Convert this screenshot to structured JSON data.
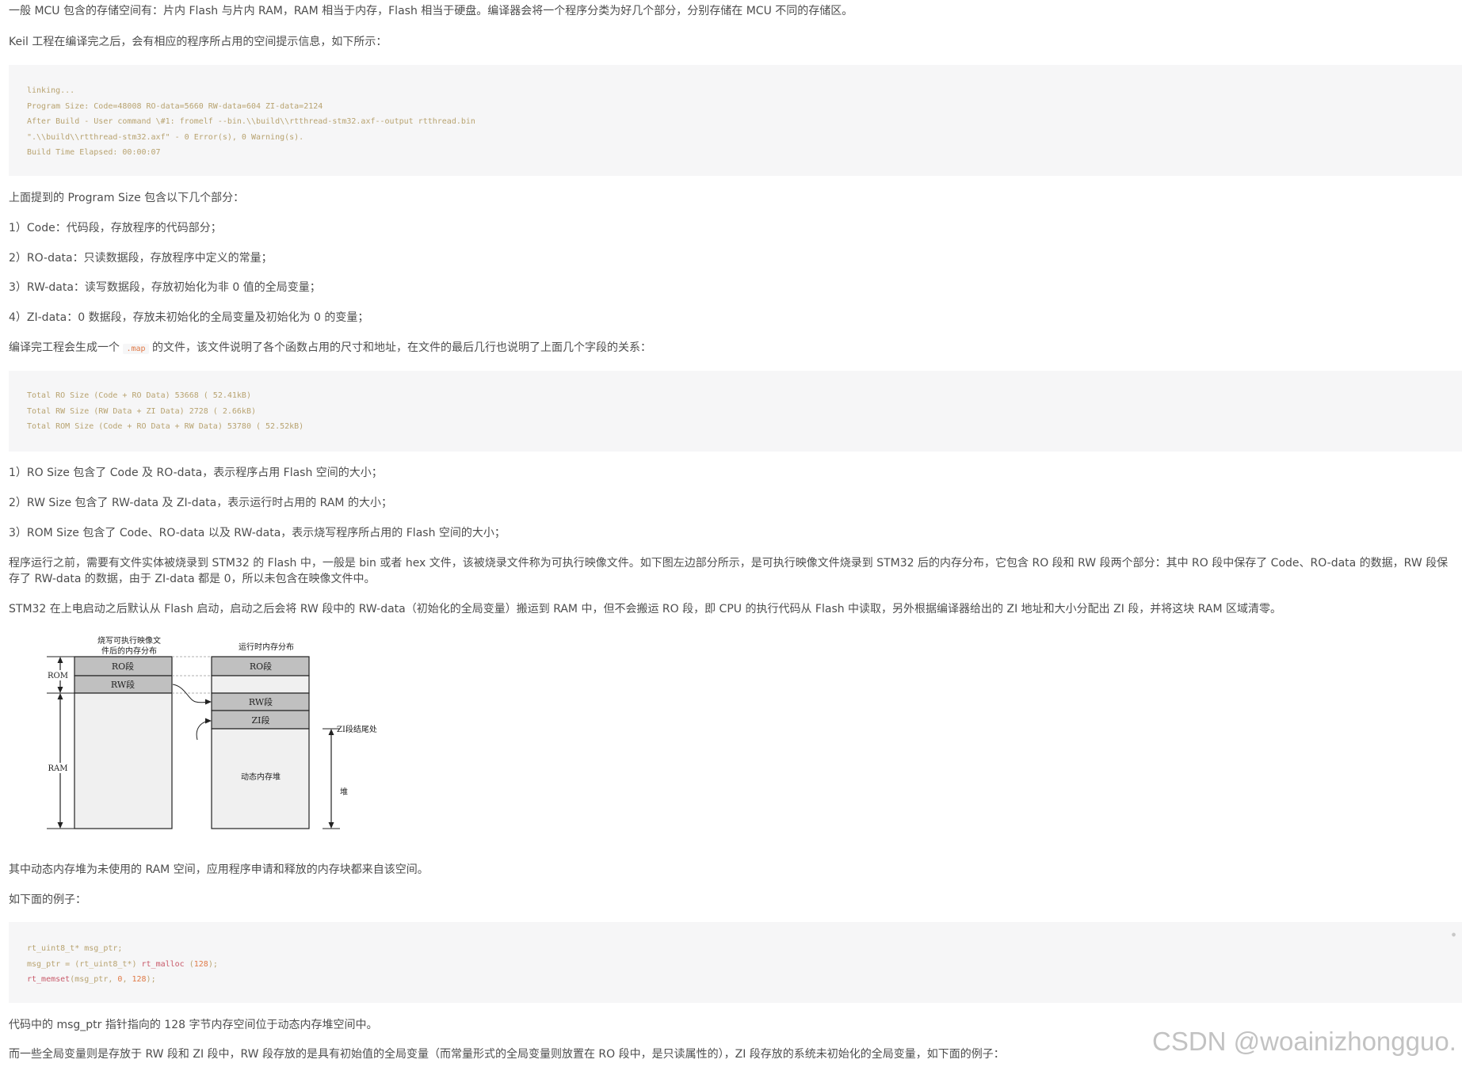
{
  "paragraphs": {
    "p1": "一般 MCU 包含的存储空间有：片内 Flash 与片内 RAM，RAM 相当于内存，Flash 相当于硬盘。编译器会将一个程序分类为好几个部分，分别存储在 MCU 不同的存储区。",
    "p2": "Keil 工程在编译完之后，会有相应的程序所占用的空间提示信息，如下所示：",
    "p3": "上面提到的 Program Size 包含以下几个部分：",
    "p4": "1）Code：代码段，存放程序的代码部分；",
    "p5": "2）RO-data：只读数据段，存放程序中定义的常量；",
    "p6": "3）RW-data：读写数据段，存放初始化为非 0 值的全局变量；",
    "p7": "4）ZI-data：0 数据段，存放未初始化的全局变量及初始化为 0 的变量；",
    "p8_before": "编译完工程会生成一个",
    "p8_code": ".map",
    "p8_after": "的文件，该文件说明了各个函数占用的尺寸和地址，在文件的最后几行也说明了上面几个字段的关系：",
    "p9": "1）RO Size 包含了 Code 及 RO-data，表示程序占用 Flash 空间的大小；",
    "p10": "2）RW Size 包含了 RW-data 及 ZI-data，表示运行时占用的 RAM 的大小；",
    "p11": "3）ROM Size 包含了 Code、RO-data 以及 RW-data，表示烧写程序所占用的 Flash 空间的大小；",
    "p12": "程序运行之前，需要有文件实体被烧录到 STM32 的 Flash 中，一般是 bin 或者 hex 文件，该被烧录文件称为可执行映像文件。如下图左边部分所示，是可执行映像文件烧录到 STM32 后的内存分布，它包含 RO 段和 RW 段两个部分：其中 RO 段中保存了 Code、RO-data 的数据，RW 段保存了 RW-data 的数据，由于 ZI-data 都是 0，所以未包含在映像文件中。",
    "p13": "STM32 在上电启动之后默认从 Flash 启动，启动之后会将 RW 段中的 RW-data（初始化的全局变量）搬运到 RAM 中，但不会搬运 RO 段，即 CPU 的执行代码从 Flash 中读取，另外根据编译器给出的 ZI 地址和大小分配出 ZI 段，并将这块 RAM 区域清零。",
    "p14": "其中动态内存堆为未使用的 RAM 空间，应用程序申请和释放的内存块都来自该空间。",
    "p15": "如下面的例子：",
    "p16": "代码中的 msg_ptr 指针指向的 128 字节内存空间位于动态内存堆空间中。",
    "p17": "而一些全局变量则是存放于 RW 段和 ZI 段中，RW 段存放的是具有初始值的全局变量（而常量形式的全局变量则放置在 RO 段中，是只读属性的），ZI 段存放的系统未初始化的全局变量，如下面的例子："
  },
  "code1": {
    "l1": "linking...",
    "l2": "Program Size: Code=48008 RO-data=5660 RW-data=604 ZI-data=2124",
    "l3": "After Build - User command \\#1: fromelf --bin.\\\\build\\\\rtthread-stm32.axf--output rtthread.bin",
    "l4": "\".\\\\build\\\\rtthread-stm32.axf\" - 0 Error(s), 0 Warning(s).",
    "l5": "Build Time Elapsed: 00:00:07"
  },
  "code2": {
    "l1": "Total RO Size (Code + RO Data) 53668 ( 52.41kB)",
    "l2": "Total RW Size (RW Data + ZI Data) 2728 ( 2.66kB)",
    "l3": "Total ROM Size (Code + RO Data + RW Data) 53780 ( 52.52kB)"
  },
  "code3": {
    "l1_type": "rt_uint8_t",
    "l1_rest": "* msg_ptr;",
    "l2_a": "msg_ptr = (",
    "l2_type": "rt_uint8_t",
    "l2_b": "*) ",
    "l2_fn": "rt_malloc",
    "l2_c": " (",
    "l2_num": "128",
    "l2_d": ");",
    "l3_fn": "rt_memset",
    "l3_a": "(msg_ptr, ",
    "l3_num1": "0",
    "l3_b": ", ",
    "l3_num2": "128",
    "l3_c": ");"
  },
  "diagram": {
    "left_title_1": "烧写可执行映像文",
    "left_title_2": "件后的内存分布",
    "right_title": "运行时内存分布",
    "rom_label": "ROM",
    "ram_label": "RAM",
    "ro_segment": "RO段",
    "rw_segment": "RW段",
    "zi_segment": "ZI段",
    "heap_area": "动态内存堆",
    "zi_end_label": "ZI段结尾处",
    "heap_label": "堆"
  },
  "watermark": "CSDN @woainizhongguo.",
  "colors": {
    "text": "#4d4d4d",
    "code_bg": "#f6f6f7",
    "code_text": "#b8a370",
    "code_fn": "#c85a6a",
    "code_num": "#e07a47"
  }
}
